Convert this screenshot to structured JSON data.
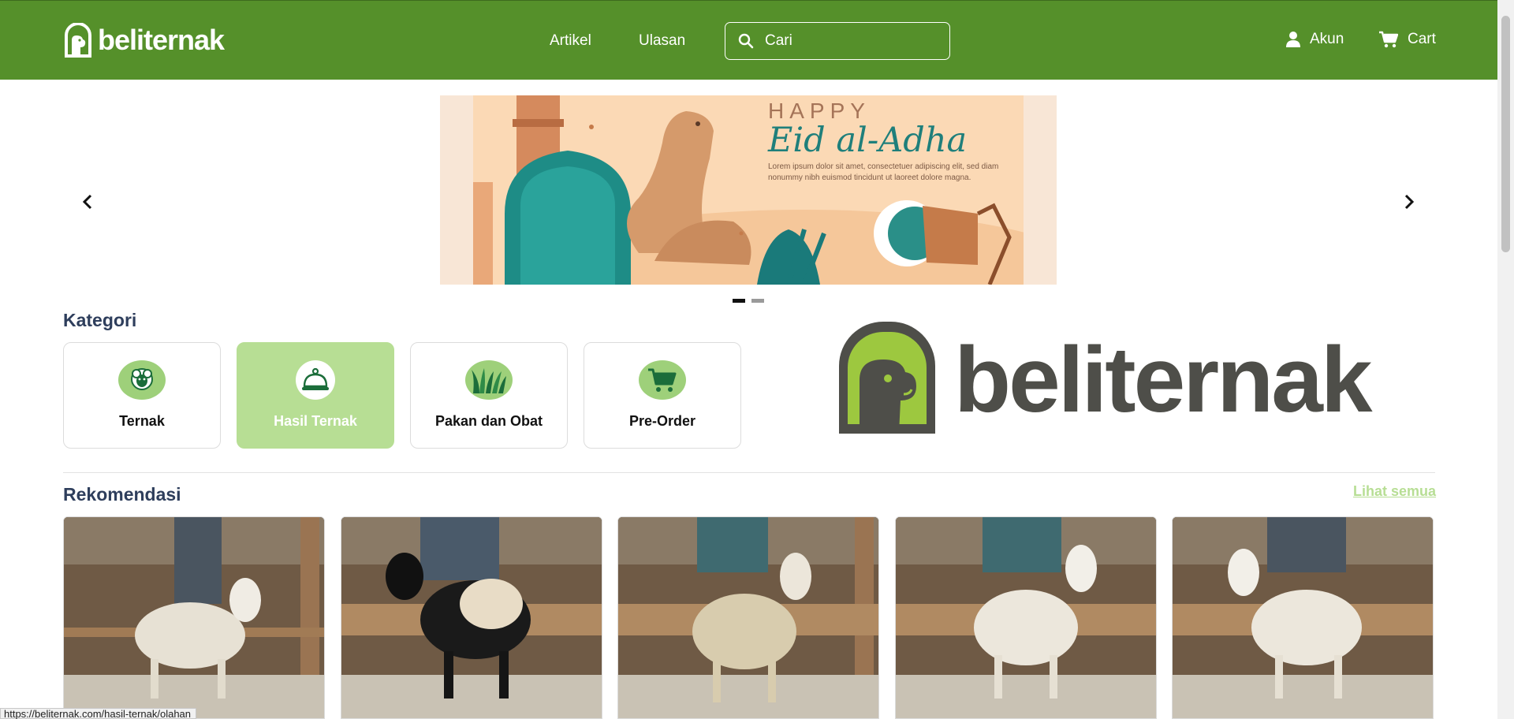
{
  "header": {
    "logo_text": "beliternak",
    "nav": {
      "artikel": "Artikel",
      "ulasan": "Ulasan"
    },
    "search_placeholder": "Cari",
    "akun_label": "Akun",
    "cart_label": "Cart"
  },
  "banner": {
    "happy": "HAPPY",
    "title": "Eid al-Adha",
    "lorem": "Lorem ipsum dolor sit amet, consectetuer adipiscing elit, sed diam nonummy nibh euismod tincidunt ut laoreet dolore magna.",
    "active_slide": 1,
    "slide_count": 2
  },
  "kategori": {
    "title": "Kategori",
    "items": [
      {
        "label": "Ternak",
        "icon": "sheep-icon",
        "active": false
      },
      {
        "label": "Hasil Ternak",
        "icon": "cloche-icon",
        "active": true
      },
      {
        "label": "Pakan dan Obat",
        "icon": "grass-icon",
        "active": false
      },
      {
        "label": "Pre-Order",
        "icon": "cart-icon",
        "active": false
      }
    ]
  },
  "brand_logo_text": "beliternak",
  "rekomendasi": {
    "title": "Rekomendasi",
    "see_all": "Lihat semua",
    "products": [
      {
        "image": "white-sheep-photo"
      },
      {
        "image": "black-white-sheep-photo"
      },
      {
        "image": "woolly-sheep-photo"
      },
      {
        "image": "white-sheep-photo"
      },
      {
        "image": "white-sheep-photo"
      }
    ]
  },
  "status_url": "https://beliternak.com/hasil-ternak/olahan",
  "colors": {
    "header_green": "#55902a",
    "accent_light_green": "#b7de94",
    "icon_green": "#9ed07a",
    "heading_navy": "#2e3e5c",
    "logo_gray": "#4e4e49"
  }
}
